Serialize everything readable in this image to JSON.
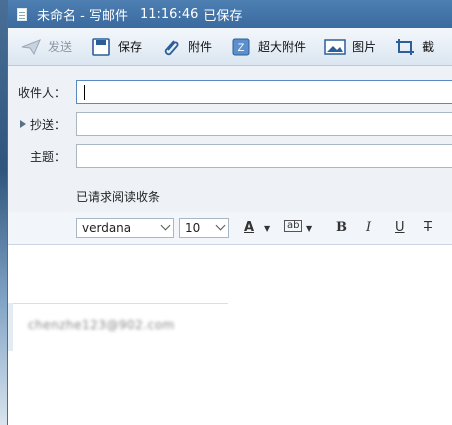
{
  "window": {
    "title": "未命名 - 写邮件",
    "time": "11:16:46",
    "save_status": "已保存"
  },
  "toolbar": {
    "send": "发送",
    "save": "保存",
    "attach": "附件",
    "big_attach": "超大附件",
    "image": "图片",
    "cut_partial": "截"
  },
  "form": {
    "to_label": "收件人：",
    "to_value": "",
    "cc_label": "抄送：",
    "cc_value": "",
    "subject_label": "主题：",
    "subject_value": ""
  },
  "receipt": "已请求阅读收条",
  "format": {
    "font": "verdana",
    "size": "10",
    "font_color": "A",
    "bg_color": "ab",
    "bold": "B",
    "italic": "I",
    "underline": "U",
    "strike": "T"
  },
  "signature": {
    "email": "chenzhe123@902.com"
  }
}
